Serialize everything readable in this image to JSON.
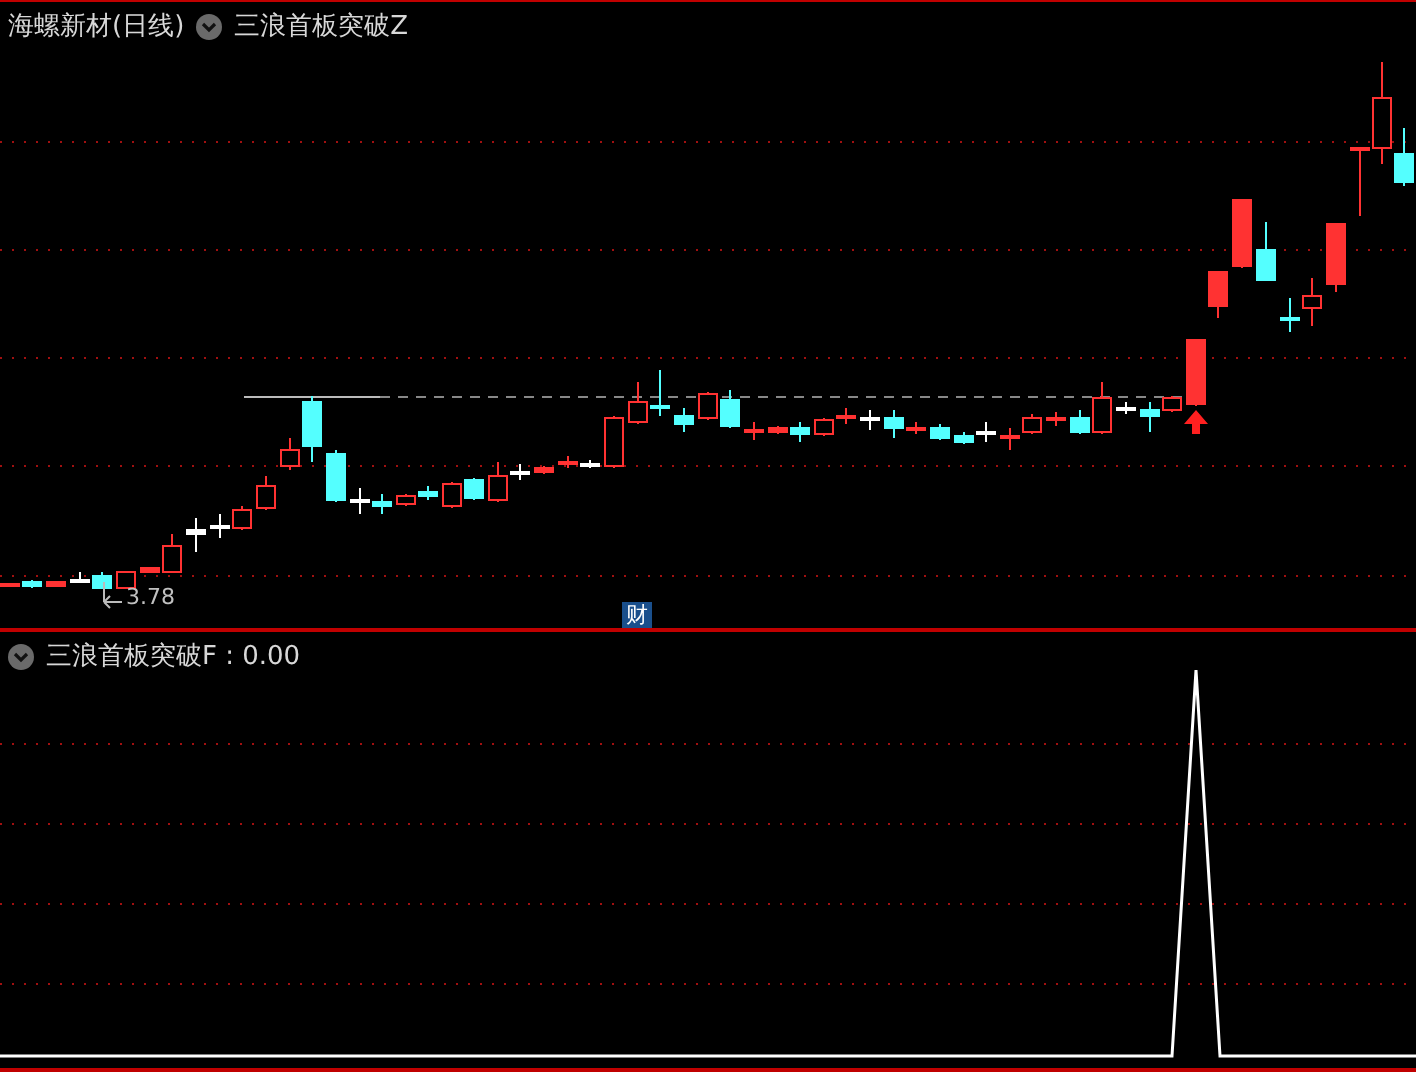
{
  "main_panel": {
    "title": "海螺新材(日线)",
    "indicator": "三浪首板突破Z",
    "price_label": "3.78",
    "badge": "财"
  },
  "sub_panel": {
    "indicator": "三浪首板突破F : 0.00"
  }
}
